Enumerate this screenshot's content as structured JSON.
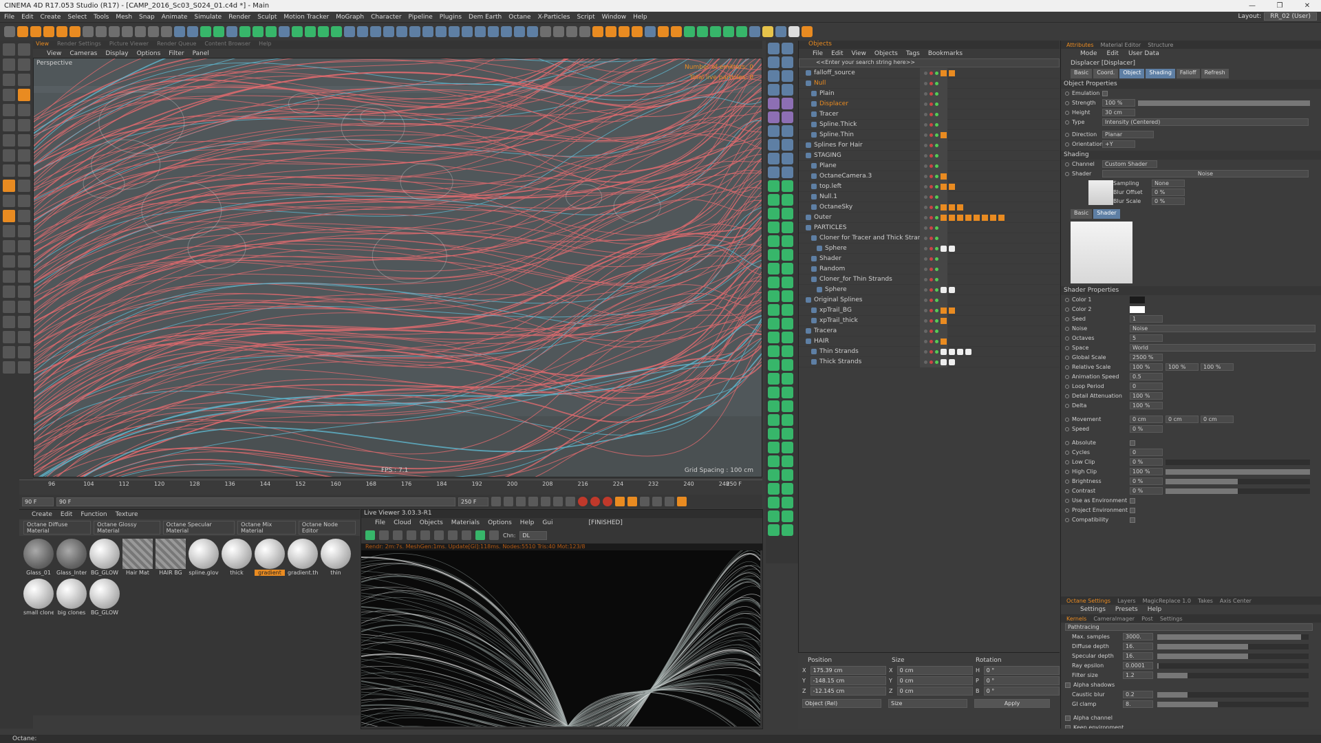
{
  "window": {
    "title": "CINEMA 4D R17.053 Studio (R17) - [CAMP_2016_Sc03_S024_01.c4d *] - Main",
    "controls": [
      "—",
      "❐",
      "✕"
    ]
  },
  "menubar": {
    "items": [
      "File",
      "Edit",
      "Create",
      "Select",
      "Tools",
      "Mesh",
      "Snap",
      "Animate",
      "Simulate",
      "Render",
      "Sculpt",
      "Motion Tracker",
      "MoGraph",
      "Character",
      "Pipeline",
      "Plugins",
      "Dem Earth",
      "Octane",
      "X-Particles",
      "Script",
      "Window",
      "Help"
    ],
    "layout_label": "Layout:",
    "layout_value": "RR_02 (User)"
  },
  "viewport": {
    "tabs": [
      "View",
      "Render Settings",
      "Picture Viewer",
      "Render Queue",
      "Content Browser",
      "Help"
    ],
    "menu": [
      "View",
      "Cameras",
      "Display",
      "Options",
      "Filter",
      "Panel"
    ],
    "label": "Perspective",
    "emitters": "Number of emitters: 0",
    "particles": "Total live particles: 0",
    "grid": "Grid Spacing : 100 cm",
    "fps": "FPS : 7.1"
  },
  "timeline": {
    "ticks": [
      "96",
      "104",
      "112",
      "120",
      "128",
      "136",
      "144",
      "152",
      "160",
      "168",
      "176",
      "184",
      "192",
      "200",
      "208",
      "216",
      "224",
      "232",
      "240",
      "248"
    ],
    "end_frame": "250 F",
    "current": "90 F",
    "start": "90 F",
    "range_end": "250 F"
  },
  "materials": {
    "menu": [
      "Create",
      "Edit",
      "Function",
      "Texture"
    ],
    "types": [
      "Octane Diffuse Material",
      "Octane Glossy Material",
      "Octane Specular Material",
      "Octane Mix Material",
      "Octane Node Editor"
    ],
    "items": [
      {
        "name": "Glass_01",
        "kind": "glass"
      },
      {
        "name": "Glass_Inter",
        "kind": "glass"
      },
      {
        "name": "BG_GLOW",
        "kind": "ball"
      },
      {
        "name": "Hair Mat",
        "kind": "hair"
      },
      {
        "name": "HAIR BG",
        "kind": "hair"
      },
      {
        "name": "spline.glov",
        "kind": "ball"
      },
      {
        "name": "thick",
        "kind": "ball"
      },
      {
        "name": "gradient",
        "kind": "ball",
        "selected": true
      },
      {
        "name": "gradient.th",
        "kind": "ball"
      },
      {
        "name": "thin",
        "kind": "ball"
      },
      {
        "name": "small clone",
        "kind": "ball"
      },
      {
        "name": "big clones",
        "kind": "ball"
      },
      {
        "name": "BG_GLOW",
        "kind": "ball"
      }
    ]
  },
  "liveviewer": {
    "title": "Live Viewer 3.03.3-R1",
    "menu": [
      "File",
      "Cloud",
      "Objects",
      "Materials",
      "Options",
      "Help",
      "Gui"
    ],
    "state": "[FINISHED]",
    "channel_label": "Chn:",
    "channel_value": "DL",
    "status": "Rendr: 2m:7s. MeshGen:1ms. Update[Gl]:118ms. Nodes:5510 Tris:40 Mot:123/8"
  },
  "objects": {
    "header": "Objects",
    "menu": [
      "File",
      "Edit",
      "View",
      "Objects",
      "Tags",
      "Bookmarks"
    ],
    "search_placeholder": "<<Enter your search string here>>",
    "rows": [
      {
        "name": "falloff_source",
        "depth": 0
      },
      {
        "name": "Null",
        "depth": 0,
        "sel": true
      },
      {
        "name": "Plain",
        "depth": 1
      },
      {
        "name": "Displacer",
        "depth": 1,
        "sel": true
      },
      {
        "name": "Tracer",
        "depth": 1
      },
      {
        "name": "Spline.Thick",
        "depth": 1
      },
      {
        "name": "Spline.Thin",
        "depth": 1
      },
      {
        "name": "Splines For Hair",
        "depth": 0
      },
      {
        "name": "STAGING",
        "depth": 0
      },
      {
        "name": "Plane",
        "depth": 1
      },
      {
        "name": "OctaneCamera.3",
        "depth": 1
      },
      {
        "name": "top.left",
        "depth": 1
      },
      {
        "name": "Null.1",
        "depth": 1
      },
      {
        "name": "OctaneSky",
        "depth": 1
      },
      {
        "name": "Outer",
        "depth": 0
      },
      {
        "name": "PARTICLES",
        "depth": 0
      },
      {
        "name": "Cloner for Tracer and Thick Strands",
        "depth": 1
      },
      {
        "name": "Sphere",
        "depth": 2
      },
      {
        "name": "Shader",
        "depth": 1
      },
      {
        "name": "Random",
        "depth": 1
      },
      {
        "name": "Cloner_for Thin Strands",
        "depth": 1
      },
      {
        "name": "Sphere",
        "depth": 2
      },
      {
        "name": "Original Splines",
        "depth": 0
      },
      {
        "name": "xpTrail_BG",
        "depth": 1
      },
      {
        "name": "xpTrail_thick",
        "depth": 1
      },
      {
        "name": "Tracera",
        "depth": 0
      },
      {
        "name": "HAIR",
        "depth": 0
      },
      {
        "name": "Thin Strands",
        "depth": 1
      },
      {
        "name": "Thick Strands",
        "depth": 1
      }
    ]
  },
  "coords": {
    "headers": [
      "Position",
      "Size",
      "Rotation"
    ],
    "rows": [
      {
        "p_axis": "X",
        "p": "175.39 cm",
        "s_axis": "X",
        "s": "0 cm",
        "r_axis": "H",
        "r": "0 °"
      },
      {
        "p_axis": "Y",
        "p": "-148.15 cm",
        "s_axis": "Y",
        "s": "0 cm",
        "r_axis": "P",
        "r": "0 °"
      },
      {
        "p_axis": "Z",
        "p": "-12.145 cm",
        "s_axis": "Z",
        "s": "0 cm",
        "r_axis": "B",
        "r": "0 °"
      }
    ],
    "mode": "Object (Rel)",
    "size_mode": "Size",
    "apply": "Apply"
  },
  "attributes": {
    "tabs": [
      "Attributes",
      "Material Editor",
      "Structure"
    ],
    "menu": [
      "Mode",
      "Edit",
      "User Data"
    ],
    "object": "Displacer [Displacer]",
    "subtabs": [
      "Basic",
      "Coord.",
      "Object",
      "Shading",
      "Falloff",
      "Refresh"
    ],
    "obj_props": "Object Properties",
    "emulation": "Emulation",
    "strength_label": "Strength",
    "strength": "100 %",
    "height_label": "Height",
    "height": "30 cm",
    "type_label": "Type",
    "type": "Intensity (Centered)",
    "direction_label": "Direction",
    "direction": "Planar",
    "orientation_label": "Orientation",
    "orientation": "+Y",
    "shading": "Shading",
    "channel_label": "Channel",
    "channel": "Custom Shader",
    "shader_label": "Shader",
    "shader": "Noise",
    "sampling_label": "Sampling",
    "sampling": "None",
    "blur_offset_label": "Blur Offset",
    "blur_offset": "0 %",
    "blur_scale_label": "Blur Scale",
    "blur_scale": "0 %",
    "shader_tabs": [
      "Basic",
      "Shader"
    ],
    "shader_props": "Shader Properties",
    "color1_label": "Color 1",
    "color2_label": "Color 2",
    "seed_label": "Seed",
    "seed": "1",
    "noise_label": "Noise",
    "noise": "Noise",
    "octaves_label": "Octaves",
    "octaves": "5",
    "space_label": "Space",
    "space": "World",
    "global_scale_label": "Global Scale",
    "global_scale": "2500 %",
    "relative_scale_label": "Relative Scale",
    "relative_scale": [
      "100 %",
      "100 %",
      "100 %"
    ],
    "anim_speed_label": "Animation Speed",
    "anim_speed": "0.5",
    "loop_label": "Loop Period",
    "loop": "0",
    "detail_label": "Detail Attenuation",
    "detail": "100 %",
    "delta_label": "Delta",
    "delta": "100 %",
    "movement_label": "Movement",
    "movement": [
      "0 cm",
      "0 cm",
      "0 cm"
    ],
    "speed_label": "Speed",
    "speed": "0 %",
    "absolute_label": "Absolute",
    "cycles_label": "Cycles",
    "cycles": "0",
    "lowclip_label": "Low Clip",
    "lowclip": "0 %",
    "highclip_label": "High Clip",
    "highclip": "100 %",
    "brightness_label": "Brightness",
    "brightness": "0 %",
    "contrast_label": "Contrast",
    "contrast": "0 %",
    "use_env_label": "Use as Environment",
    "proj_env_label": "Project Environment",
    "compat_label": "Compatibility",
    "levels": {
      "strength": 1.0,
      "lowclip": 0.0,
      "highclip": 1.0,
      "brightness": 0.5,
      "contrast": 0.5
    },
    "colors": {
      "color1": "#1a1a1a",
      "color2": "#ffffff"
    }
  },
  "octane": {
    "tabs": [
      "Octane Settings",
      "Layers",
      "MagicReplace 1.0",
      "Takes",
      "Axis Center"
    ],
    "menu": [
      "Settings",
      "Presets",
      "Help"
    ],
    "subtabs": [
      "Kernels",
      "CameraImager",
      "Post",
      "Settings"
    ],
    "kernel": "Pathtracing",
    "max_samples_label": "Max. samples",
    "max_samples": "3000.",
    "diffuse_label": "Diffuse depth",
    "diffuse": "16.",
    "specular_label": "Specular depth",
    "specular": "16.",
    "ray_label": "Ray epsilon",
    "ray": "0.0001",
    "filter_label": "Filter size",
    "filter": "1.2",
    "alpha_shadows_label": "Alpha shadows",
    "caustic_label": "Caustic blur",
    "caustic": "0.2",
    "giclamp_label": "GI clamp",
    "giclamp": "8.",
    "alpha_channel_label": "Alpha channel",
    "keep_env_label": "Keep environment"
  },
  "status": {
    "text": "Octane:"
  }
}
